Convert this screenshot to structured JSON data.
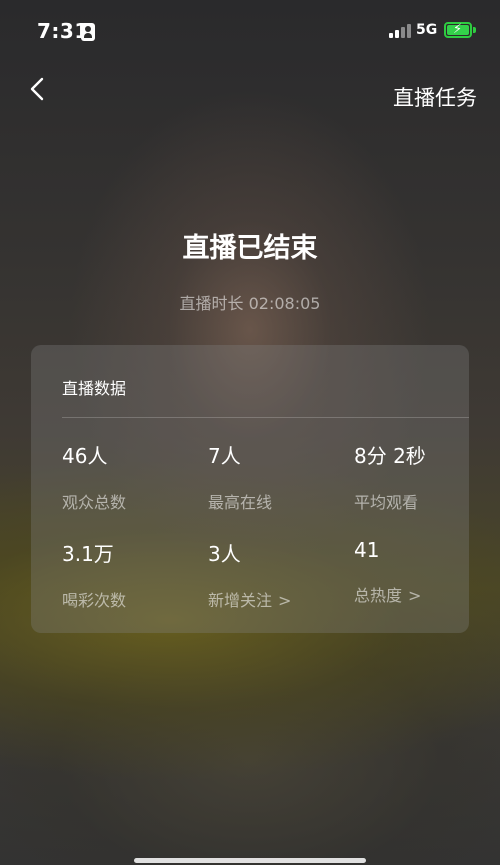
{
  "status_bar": {
    "time": "7:31",
    "network": "5G"
  },
  "nav": {
    "right_label": "直播任务"
  },
  "title": "直播已结束",
  "duration": "直播时长 02:08:05",
  "card": {
    "title": "直播数据",
    "stats": [
      {
        "value": "46人",
        "label": "观众总数"
      },
      {
        "value": "7人",
        "label": "最高在线"
      },
      {
        "value": "8分 2秒",
        "label": "平均观看"
      },
      {
        "value": "3.1万",
        "label": "喝彩次数"
      },
      {
        "value": "3人",
        "label": "新增关注"
      },
      {
        "value": "41",
        "label": "总热度"
      }
    ]
  },
  "icons": [
    "person-badge-icon",
    "signal-icon",
    "battery-charging-icon",
    "back-chevron-icon",
    "chevron-right-icon"
  ],
  "colors": {
    "battery": "#33d14a",
    "card_bg": "rgba(130,130,130,0.32)"
  }
}
